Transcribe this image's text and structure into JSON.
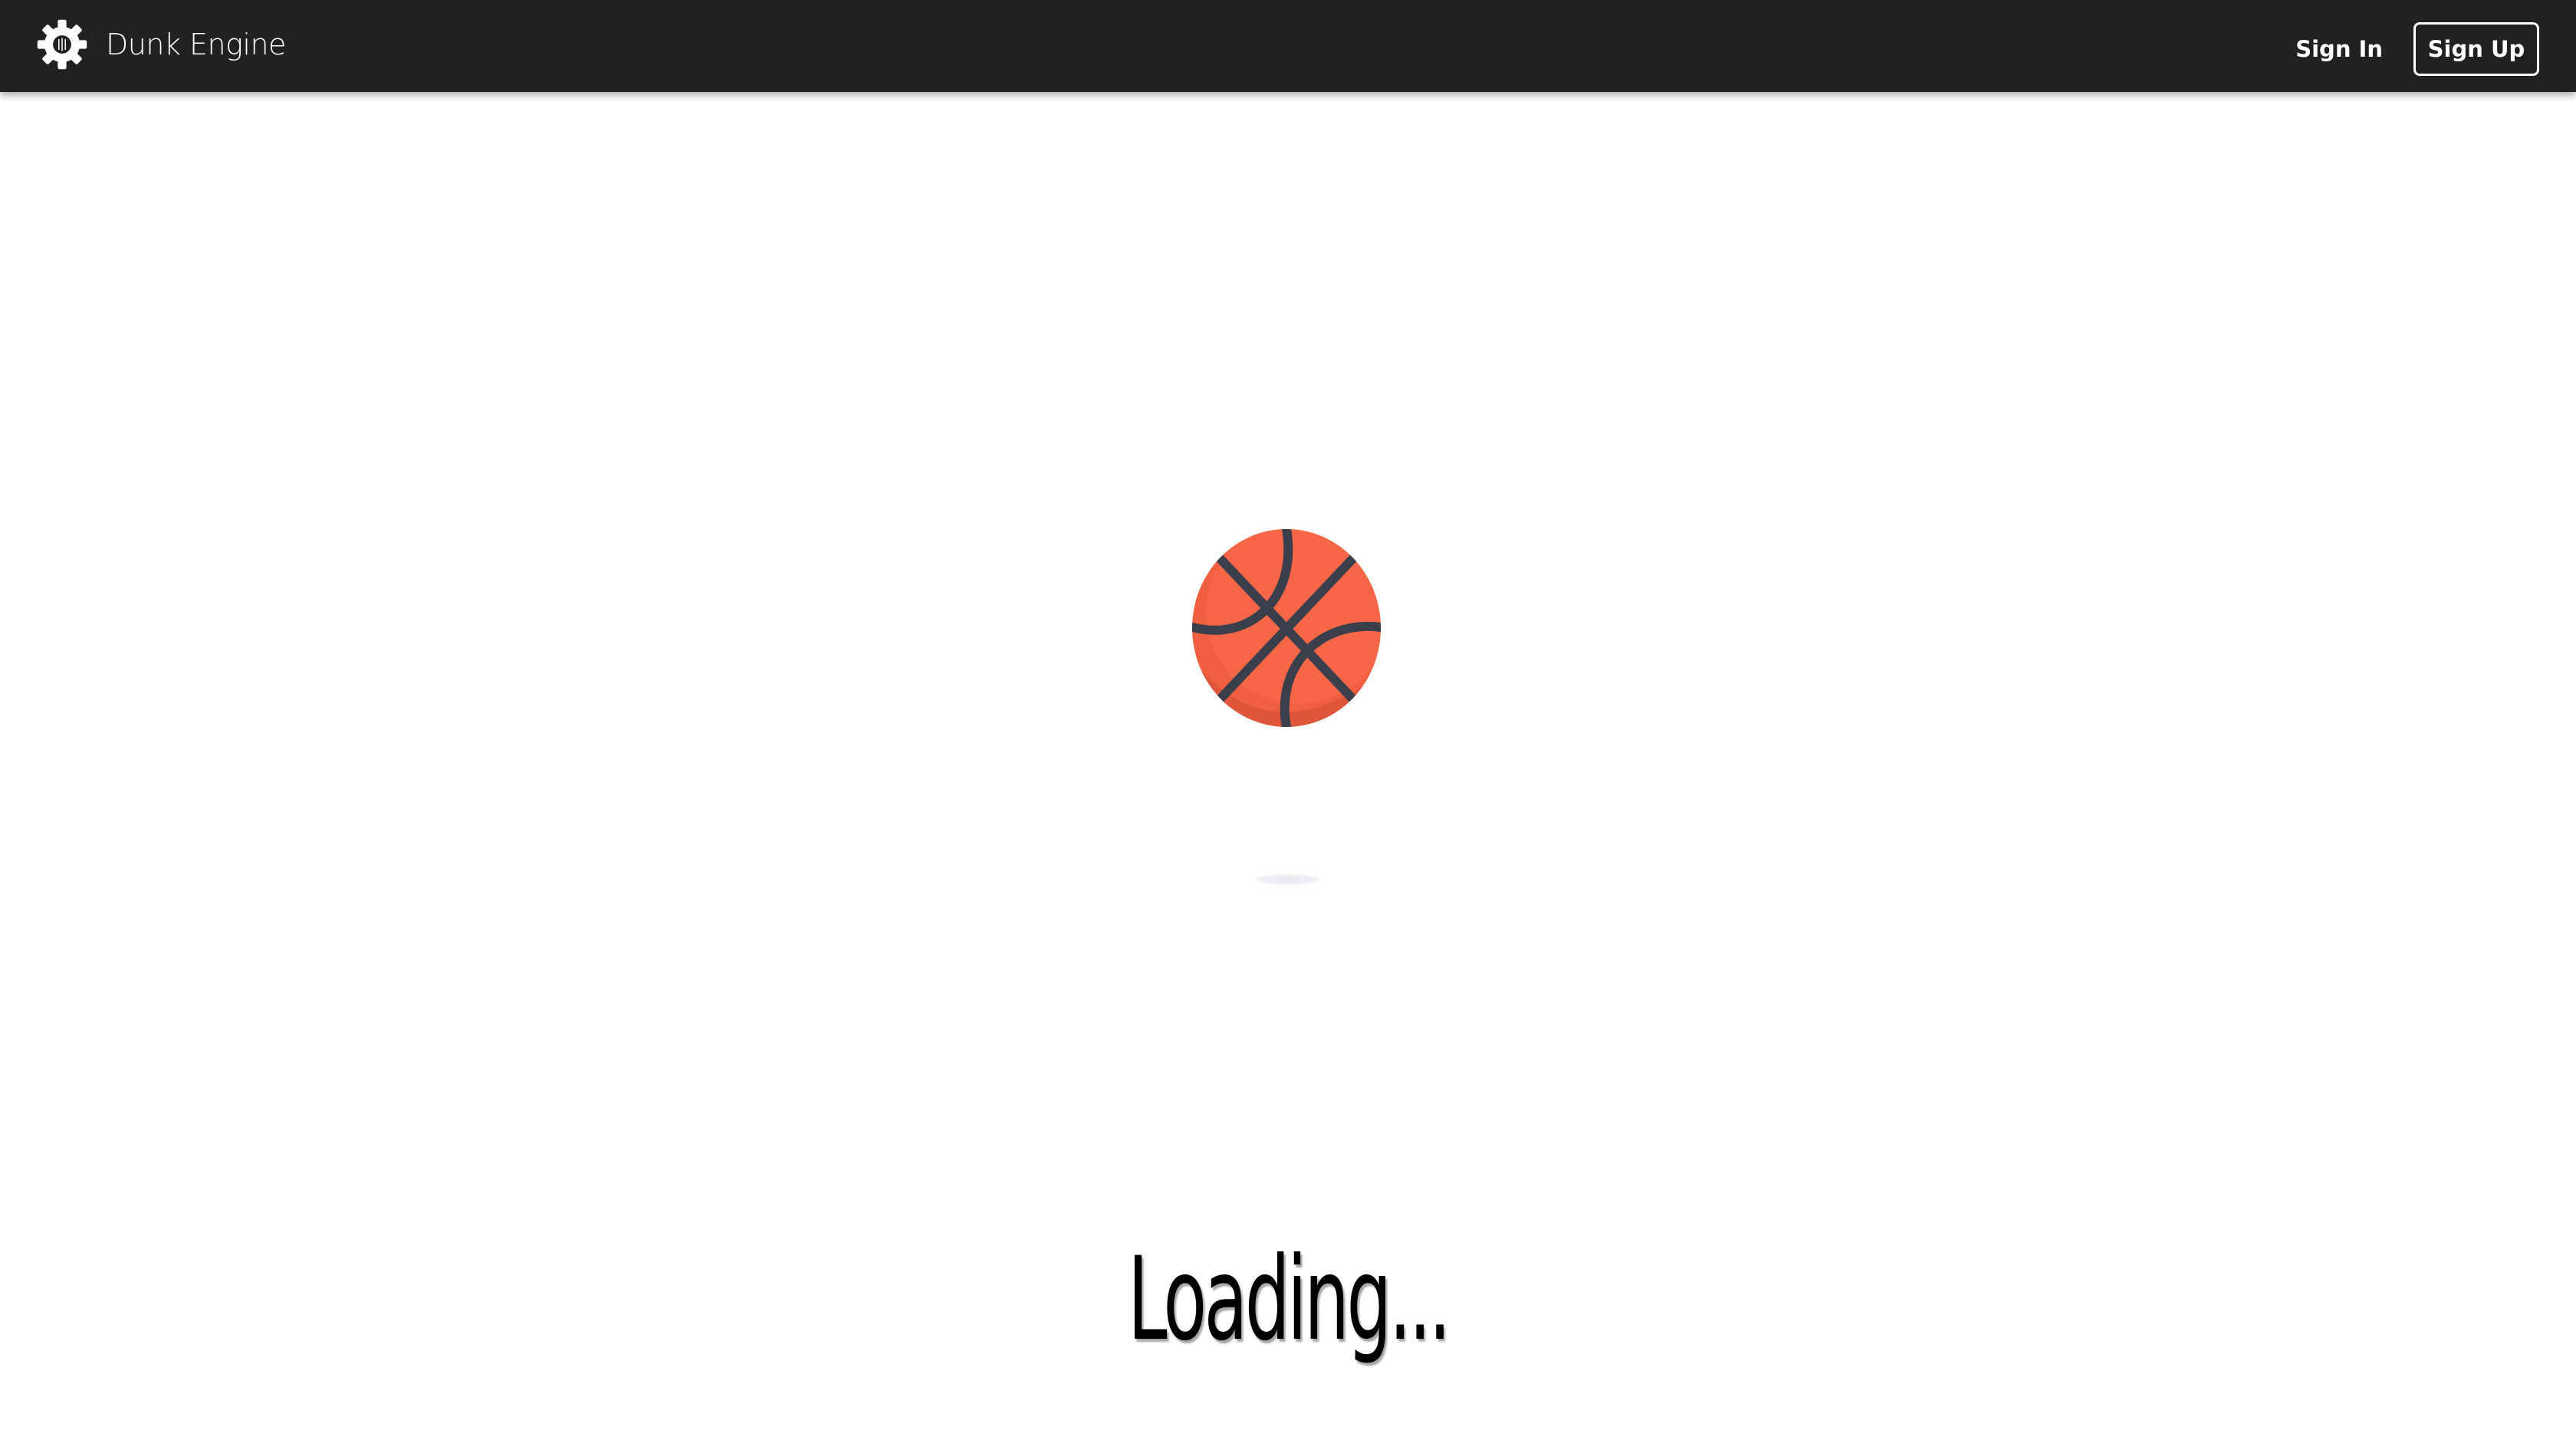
{
  "navbar": {
    "brand_name": "Dunk Engine",
    "brand_icon": "gear-icon",
    "sign_in_label": "Sign In",
    "sign_up_label": "Sign Up"
  },
  "loader": {
    "ball_icon": "basketball-icon",
    "loading_text": "Loading..."
  },
  "colors": {
    "navbar_bg": "#212121",
    "ball_fill": "#f05f40",
    "ball_seams": "#3a3f4b",
    "page_bg": "#ffffff"
  }
}
